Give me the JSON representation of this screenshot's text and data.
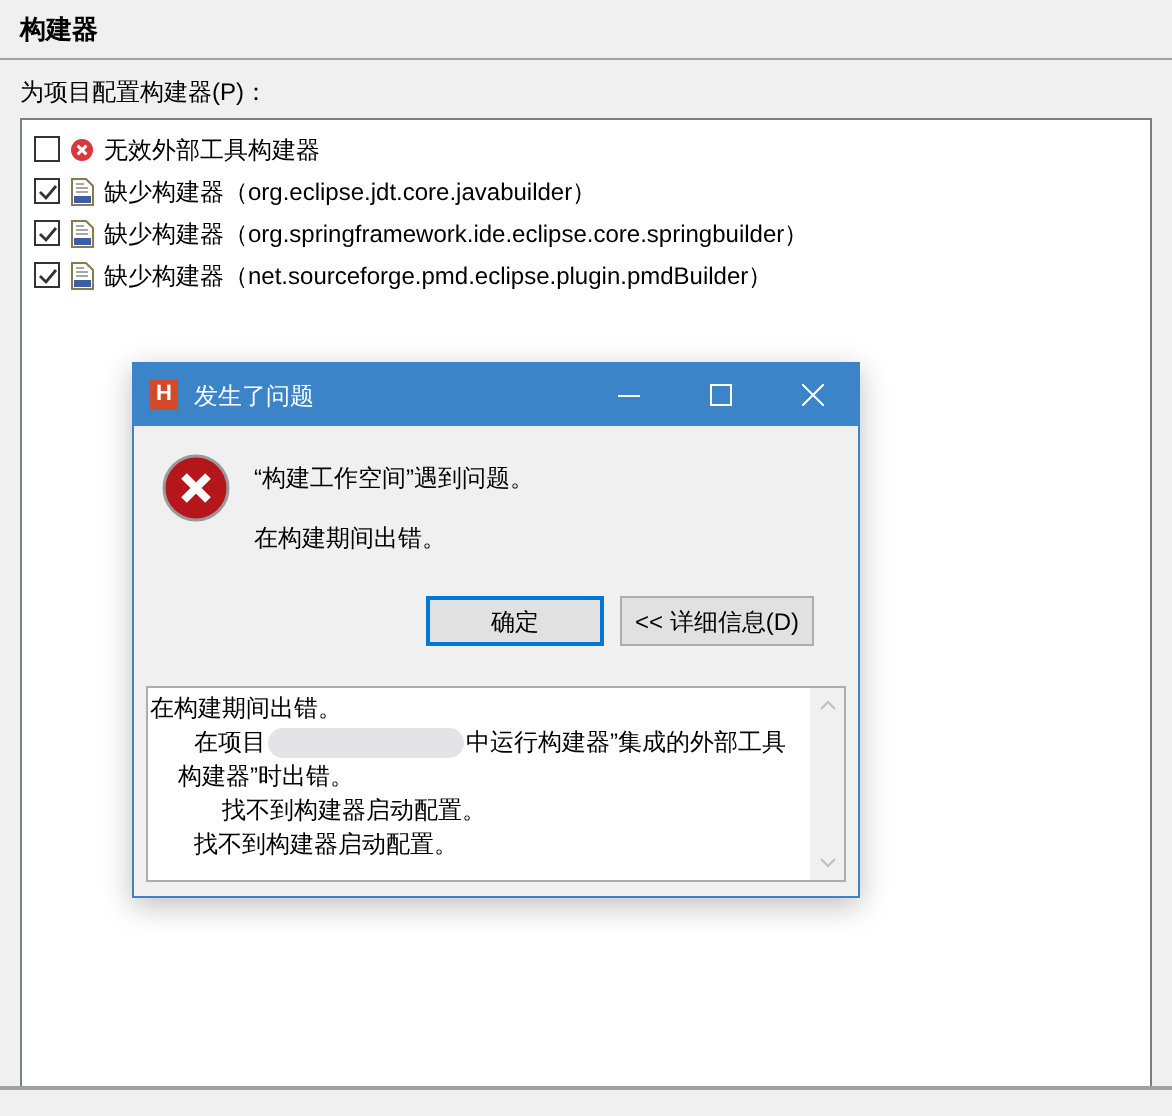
{
  "page": {
    "title": "构建器",
    "list_label": "为项目配置构建器(P)："
  },
  "builders": [
    {
      "label": "无效外部工具构建器",
      "checked": false,
      "kind": "error"
    },
    {
      "label": "缺少构建器（org.eclipse.jdt.core.javabuilder）",
      "checked": true,
      "kind": "binary"
    },
    {
      "label": "缺少构建器（org.springframework.ide.eclipse.core.springbuilder）",
      "checked": true,
      "kind": "binary"
    },
    {
      "label": "缺少构建器（net.sourceforge.pmd.eclipse.plugin.pmdBuilder）",
      "checked": true,
      "kind": "binary"
    }
  ],
  "dialog": {
    "app_icon": "H",
    "title": "发生了问题",
    "message": "“构建工作空间”遇到问题。",
    "reason": "在构建期间出错。",
    "buttons": [
      {
        "label": "确定",
        "selected": true
      },
      {
        "label": "<< 详细信息(D)",
        "selected": false
      }
    ],
    "details": {
      "text": "在构建期间出错。",
      "children": [
        {
          "text": "在项目",
          "redacted": true,
          "after": "中运行构建器”集成的外部工具",
          "continuation": "构建器”时出错。",
          "children": [
            {
              "text": "找不到构建器启动配置。"
            }
          ]
        },
        {
          "text": "找不到构建器启动配置。"
        }
      ]
    }
  }
}
